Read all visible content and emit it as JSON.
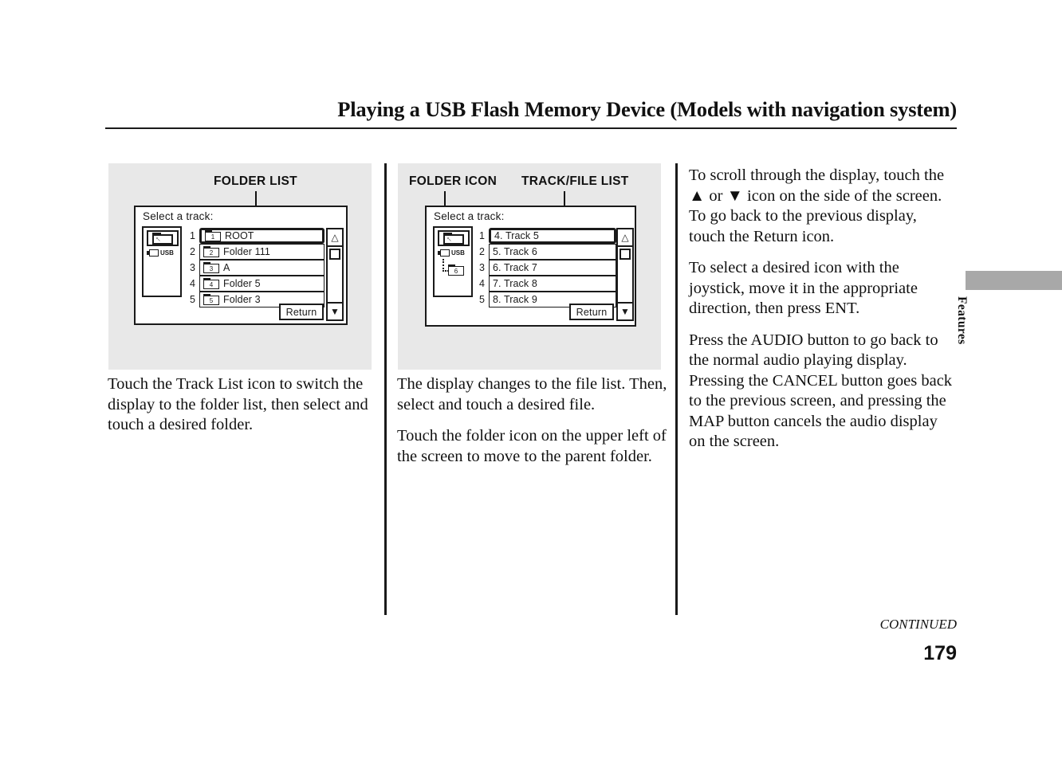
{
  "page": {
    "title": "Playing a USB Flash Memory Device (Models with navigation system)",
    "continued_label": "CONTINUED",
    "page_number": "179",
    "side_tab_label": "Features"
  },
  "figure1": {
    "callout": "FOLDER LIST",
    "screen_title": "Select a track:",
    "parent_folder_icon": "folder-up-icon",
    "device_label": "USB",
    "rows": [
      {
        "num": "1",
        "icon_num": "1",
        "text": "ROOT",
        "selected": true
      },
      {
        "num": "2",
        "icon_num": "2",
        "text": "Folder 111",
        "selected": false
      },
      {
        "num": "3",
        "icon_num": "3",
        "text": "A",
        "selected": false
      },
      {
        "num": "4",
        "icon_num": "4",
        "text": "Folder 5",
        "selected": false
      },
      {
        "num": "5",
        "icon_num": "5",
        "text": "Folder 3",
        "selected": false
      }
    ],
    "scroll_up": "△",
    "scroll_down": "▼",
    "return_label": "Return"
  },
  "figure2": {
    "callout_left": "FOLDER ICON",
    "callout_right": "TRACK/FILE LIST",
    "screen_title": "Select a track:",
    "parent_folder_icon": "folder-up-icon",
    "device_label": "USB",
    "sub_folder_num": "6",
    "rows": [
      {
        "num": "1",
        "text": "4. Track 5",
        "selected": true
      },
      {
        "num": "2",
        "text": "5. Track 6",
        "selected": false
      },
      {
        "num": "3",
        "text": "6. Track 7",
        "selected": false
      },
      {
        "num": "4",
        "text": "7. Track 8",
        "selected": false
      },
      {
        "num": "5",
        "text": "8. Track 9",
        "selected": false
      }
    ],
    "scroll_up": "△",
    "scroll_down": "▼",
    "return_label": "Return"
  },
  "column1": {
    "p1": "Touch the Track List icon to switch the display to the folder list, then select and touch a desired folder."
  },
  "column2": {
    "p1": "The display changes to the file list. Then, select and touch a desired file.",
    "p2": "Touch the folder icon on the upper left of the screen to move to the parent folder."
  },
  "column3": {
    "p1": "To scroll through the display, touch the ▲ or ▼ icon on the side of the screen. To go back to the previous display, touch the Return icon.",
    "p2": "To select a desired icon with the joystick, move it in the appropriate direction, then press ENT.",
    "p3": "Press the AUDIO button to go back to the normal audio playing display. Pressing the CANCEL button goes back to the previous screen, and pressing the MAP button cancels the audio display on the screen."
  },
  "colors": {
    "panel_bg": "#e8e8e8",
    "ink": "#111111",
    "tab_gray": "#a8a8a8"
  }
}
